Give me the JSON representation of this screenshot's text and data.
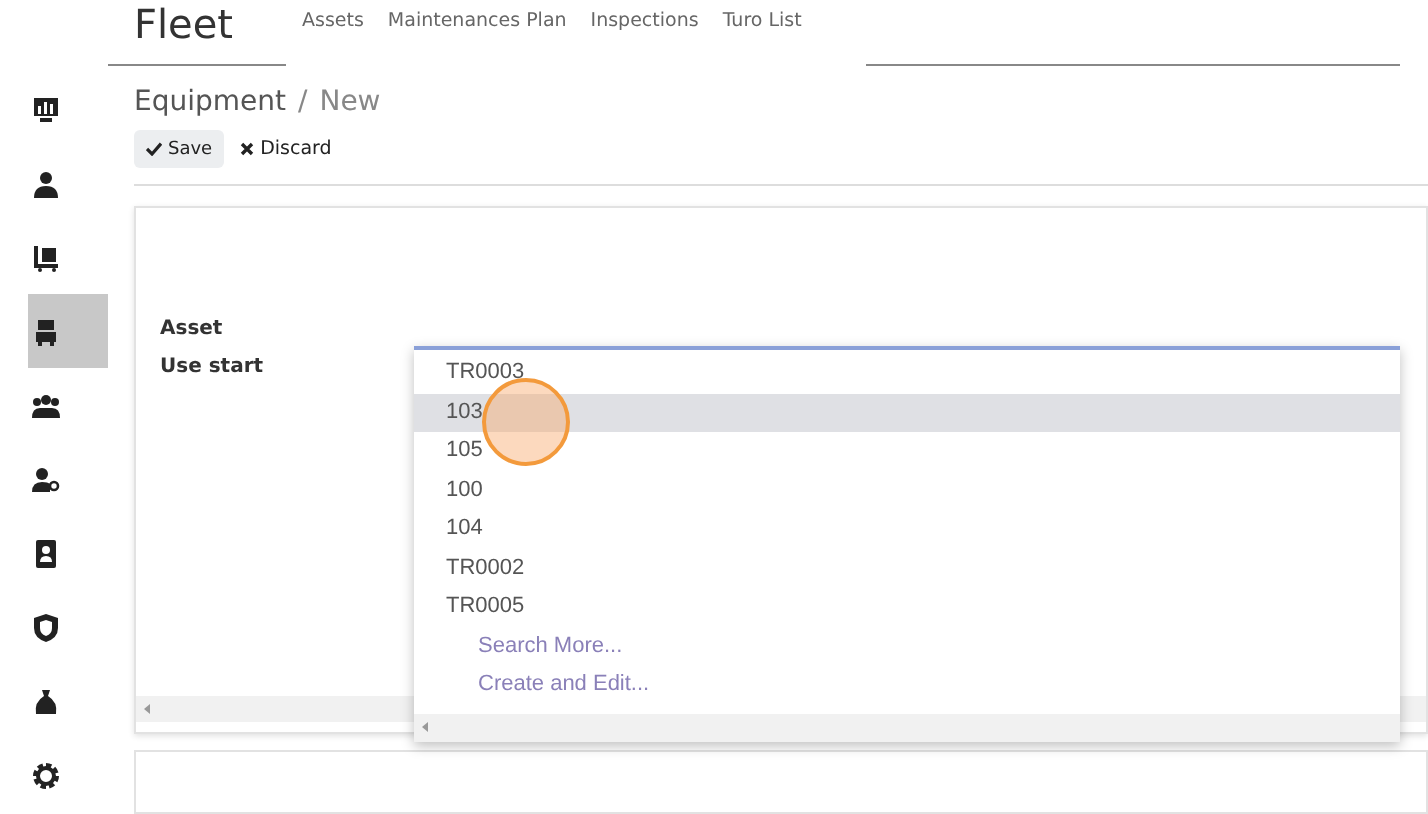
{
  "app_title": "Fleet",
  "top_menu": [
    {
      "label": "Assets"
    },
    {
      "label": "Maintenances Plan"
    },
    {
      "label": "Inspections"
    },
    {
      "label": "Turo List"
    }
  ],
  "sidebar": {
    "items": [
      {
        "selected": false
      },
      {
        "selected": false
      },
      {
        "selected": false
      },
      {
        "selected": true
      },
      {
        "selected": false
      },
      {
        "selected": false
      },
      {
        "selected": false
      },
      {
        "selected": false
      },
      {
        "selected": false
      },
      {
        "selected": false
      }
    ]
  },
  "breadcrumb": {
    "parent": "Equipment",
    "separator": "/",
    "current": "New"
  },
  "buttons": {
    "save": "Save",
    "discard": "Discard"
  },
  "form": {
    "fields": [
      {
        "label": "Asset"
      },
      {
        "label": "Use start"
      }
    ]
  },
  "dropdown": {
    "options": [
      {
        "label": "TR0003",
        "selected": false
      },
      {
        "label": "103",
        "selected": true
      },
      {
        "label": "105",
        "selected": false
      },
      {
        "label": "100",
        "selected": false
      },
      {
        "label": "104",
        "selected": false
      },
      {
        "label": "TR0002",
        "selected": false
      },
      {
        "label": "TR0005",
        "selected": false
      }
    ],
    "actions": [
      "Search More...",
      "Create and Edit..."
    ]
  }
}
